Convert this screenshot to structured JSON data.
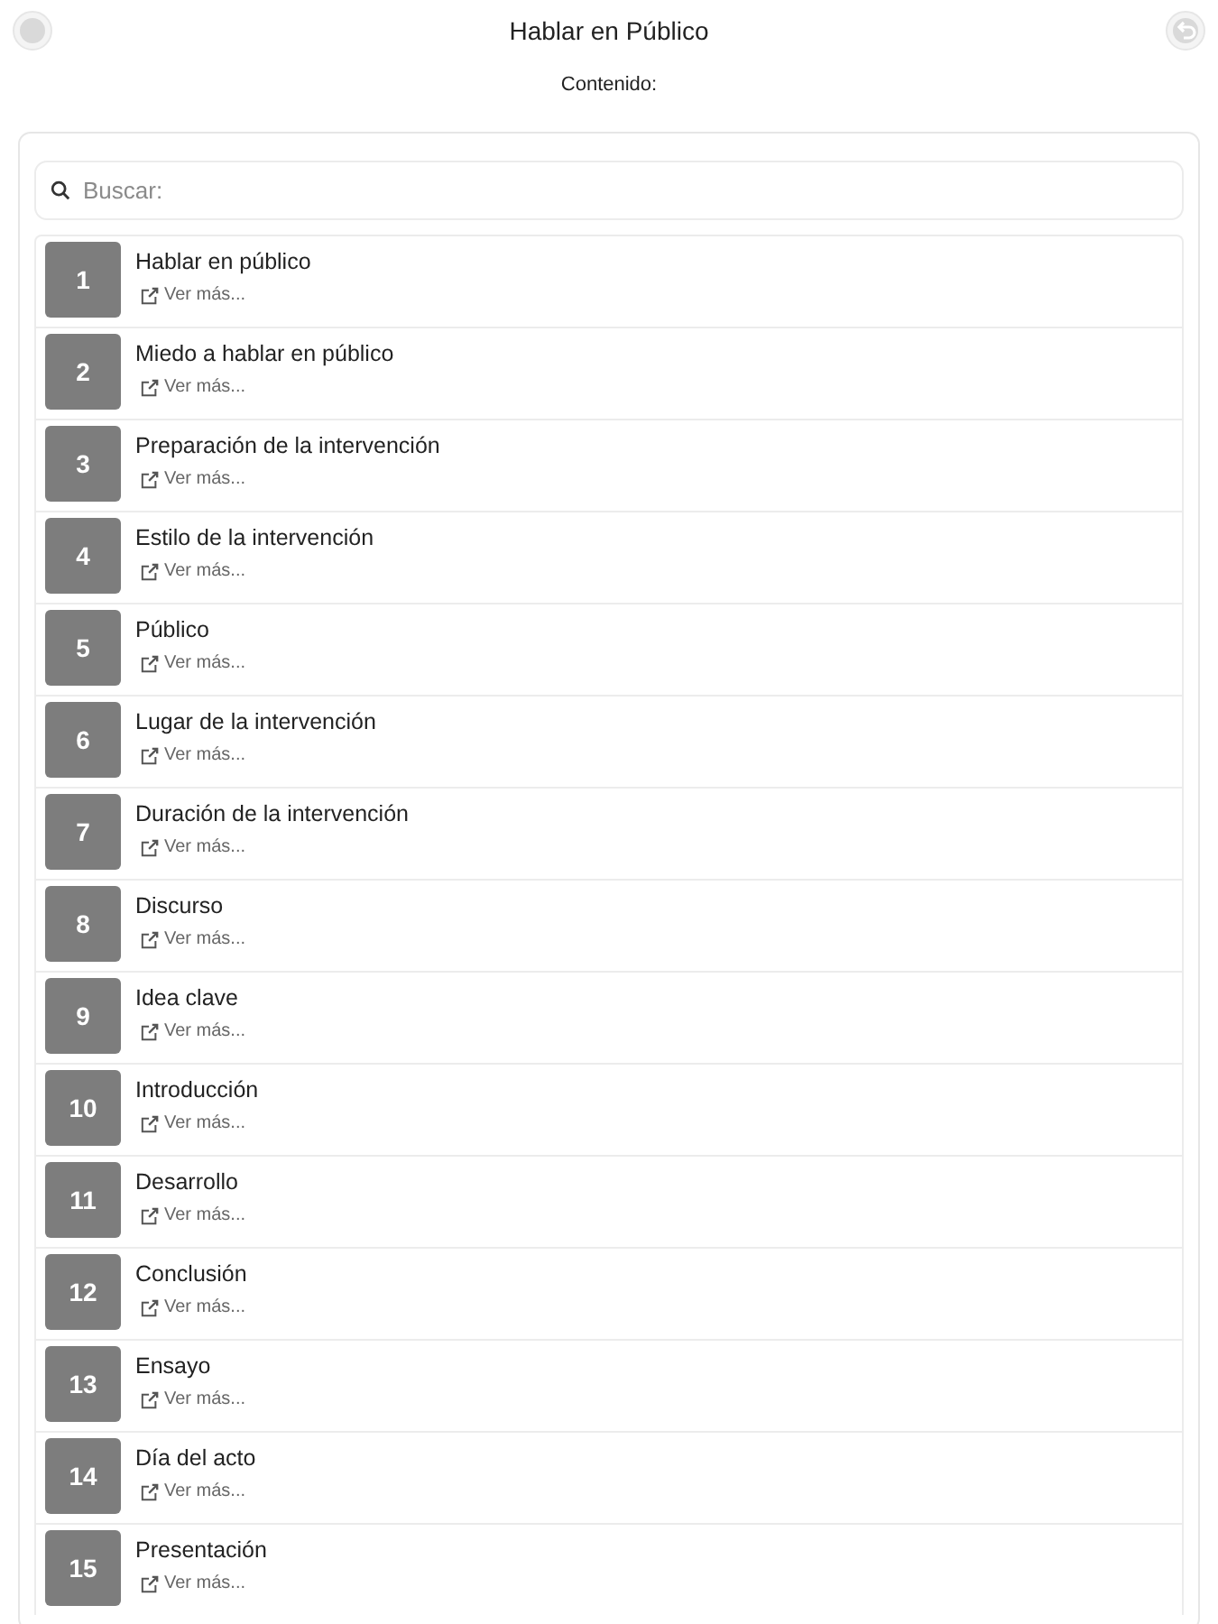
{
  "header": {
    "title": "Hablar en Público",
    "subtitle": "Contenido:"
  },
  "search": {
    "placeholder": "Buscar:"
  },
  "items": [
    {
      "number": "1",
      "title": "Hablar en público",
      "link": "Ver más..."
    },
    {
      "number": "2",
      "title": "Miedo a hablar en público",
      "link": "Ver más..."
    },
    {
      "number": "3",
      "title": "Preparación de la intervención",
      "link": "Ver más..."
    },
    {
      "number": "4",
      "title": "Estilo de la intervención",
      "link": "Ver más..."
    },
    {
      "number": "5",
      "title": "Público",
      "link": "Ver más..."
    },
    {
      "number": "6",
      "title": "Lugar de la intervención",
      "link": "Ver más..."
    },
    {
      "number": "7",
      "title": "Duración de la intervención",
      "link": "Ver más..."
    },
    {
      "number": "8",
      "title": "Discurso",
      "link": "Ver más..."
    },
    {
      "number": "9",
      "title": "Idea clave",
      "link": "Ver más..."
    },
    {
      "number": "10",
      "title": "Introducción",
      "link": "Ver más..."
    },
    {
      "number": "11",
      "title": "Desarrollo",
      "link": "Ver más..."
    },
    {
      "number": "12",
      "title": "Conclusión",
      "link": "Ver más..."
    },
    {
      "number": "13",
      "title": "Ensayo",
      "link": "Ver más..."
    },
    {
      "number": "14",
      "title": "Día del acto",
      "link": "Ver más..."
    },
    {
      "number": "15",
      "title": "Presentación",
      "link": "Ver más..."
    }
  ]
}
